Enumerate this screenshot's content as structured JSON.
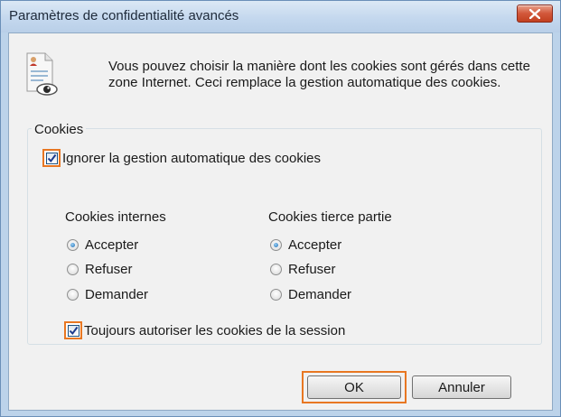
{
  "window": {
    "title": "Paramètres de confidentialité avancés",
    "close_icon": "close-icon"
  },
  "header": {
    "icon": "document-privacy-eye-icon",
    "description": "Vous pouvez choisir la manière dont les cookies sont gérés dans cette zone Internet. Ceci remplace la gestion automatique des cookies."
  },
  "cookies": {
    "group_label": "Cookies",
    "override_label": "Ignorer la gestion automatique des cookies",
    "override_checked": true,
    "first_party": {
      "title": "Cookies internes",
      "options": [
        "Accepter",
        "Refuser",
        "Demander"
      ],
      "selected": "Accepter"
    },
    "third_party": {
      "title": "Cookies tierce partie",
      "options": [
        "Accepter",
        "Refuser",
        "Demander"
      ],
      "selected": "Accepter"
    },
    "session_label": "Toujours autoriser les cookies de la session",
    "session_checked": true
  },
  "buttons": {
    "ok": "OK",
    "cancel": "Annuler"
  },
  "colors": {
    "highlight": "#e87722",
    "titlebar": "#c4d8ee",
    "close_button": "#d2573a",
    "radio_selected": "#1b6cb3"
  }
}
